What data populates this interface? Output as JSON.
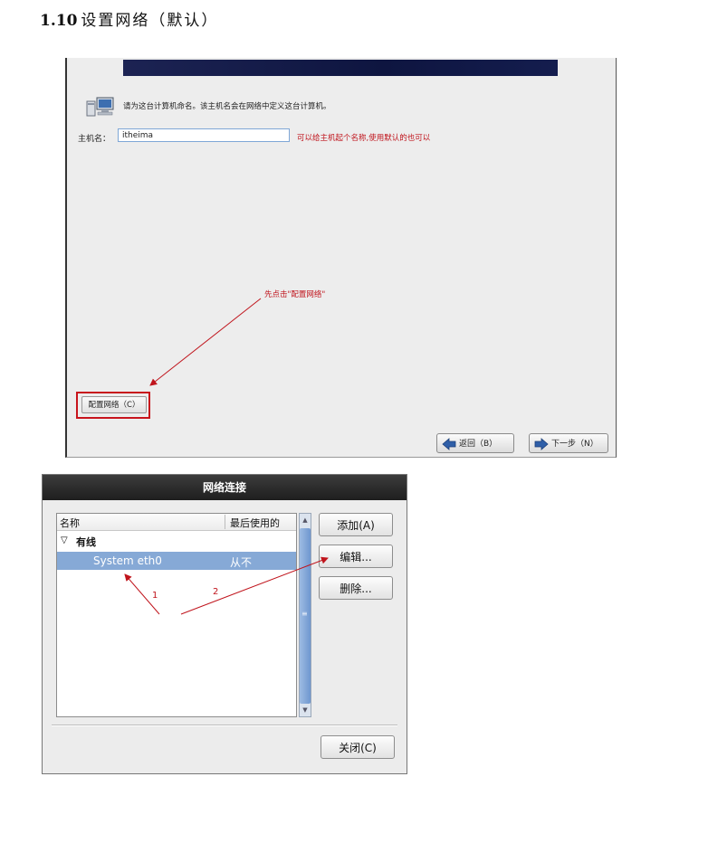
{
  "heading": {
    "number": "1.10",
    "title": "设置网络（默认）"
  },
  "installer": {
    "prompt": "请为这台计算机命名。该主机名会在网络中定义这台计算机。",
    "hostname_label": "主机名：",
    "hostname_value": "itheima",
    "hostname_note": "可以给主机起个名称,使用默认的也可以",
    "annotation": "先点击\"配置网络\"",
    "configure_button": "配置网络（C）",
    "back_button": "返回（B）",
    "next_button": "下一步（N）"
  },
  "dialog": {
    "title": "网络连接",
    "columns": {
      "name": "名称",
      "last_used": "最后使用的"
    },
    "group": "有线",
    "rows": [
      {
        "name": "System eth0",
        "last_used": "从不"
      }
    ],
    "buttons": {
      "add": "添加(A)",
      "edit": "编辑...",
      "delete": "删除...",
      "close": "关闭(C)"
    },
    "markers": [
      "1",
      "2"
    ]
  },
  "colors": {
    "annotation": "#c0141c",
    "selection": "#86a9d6"
  }
}
